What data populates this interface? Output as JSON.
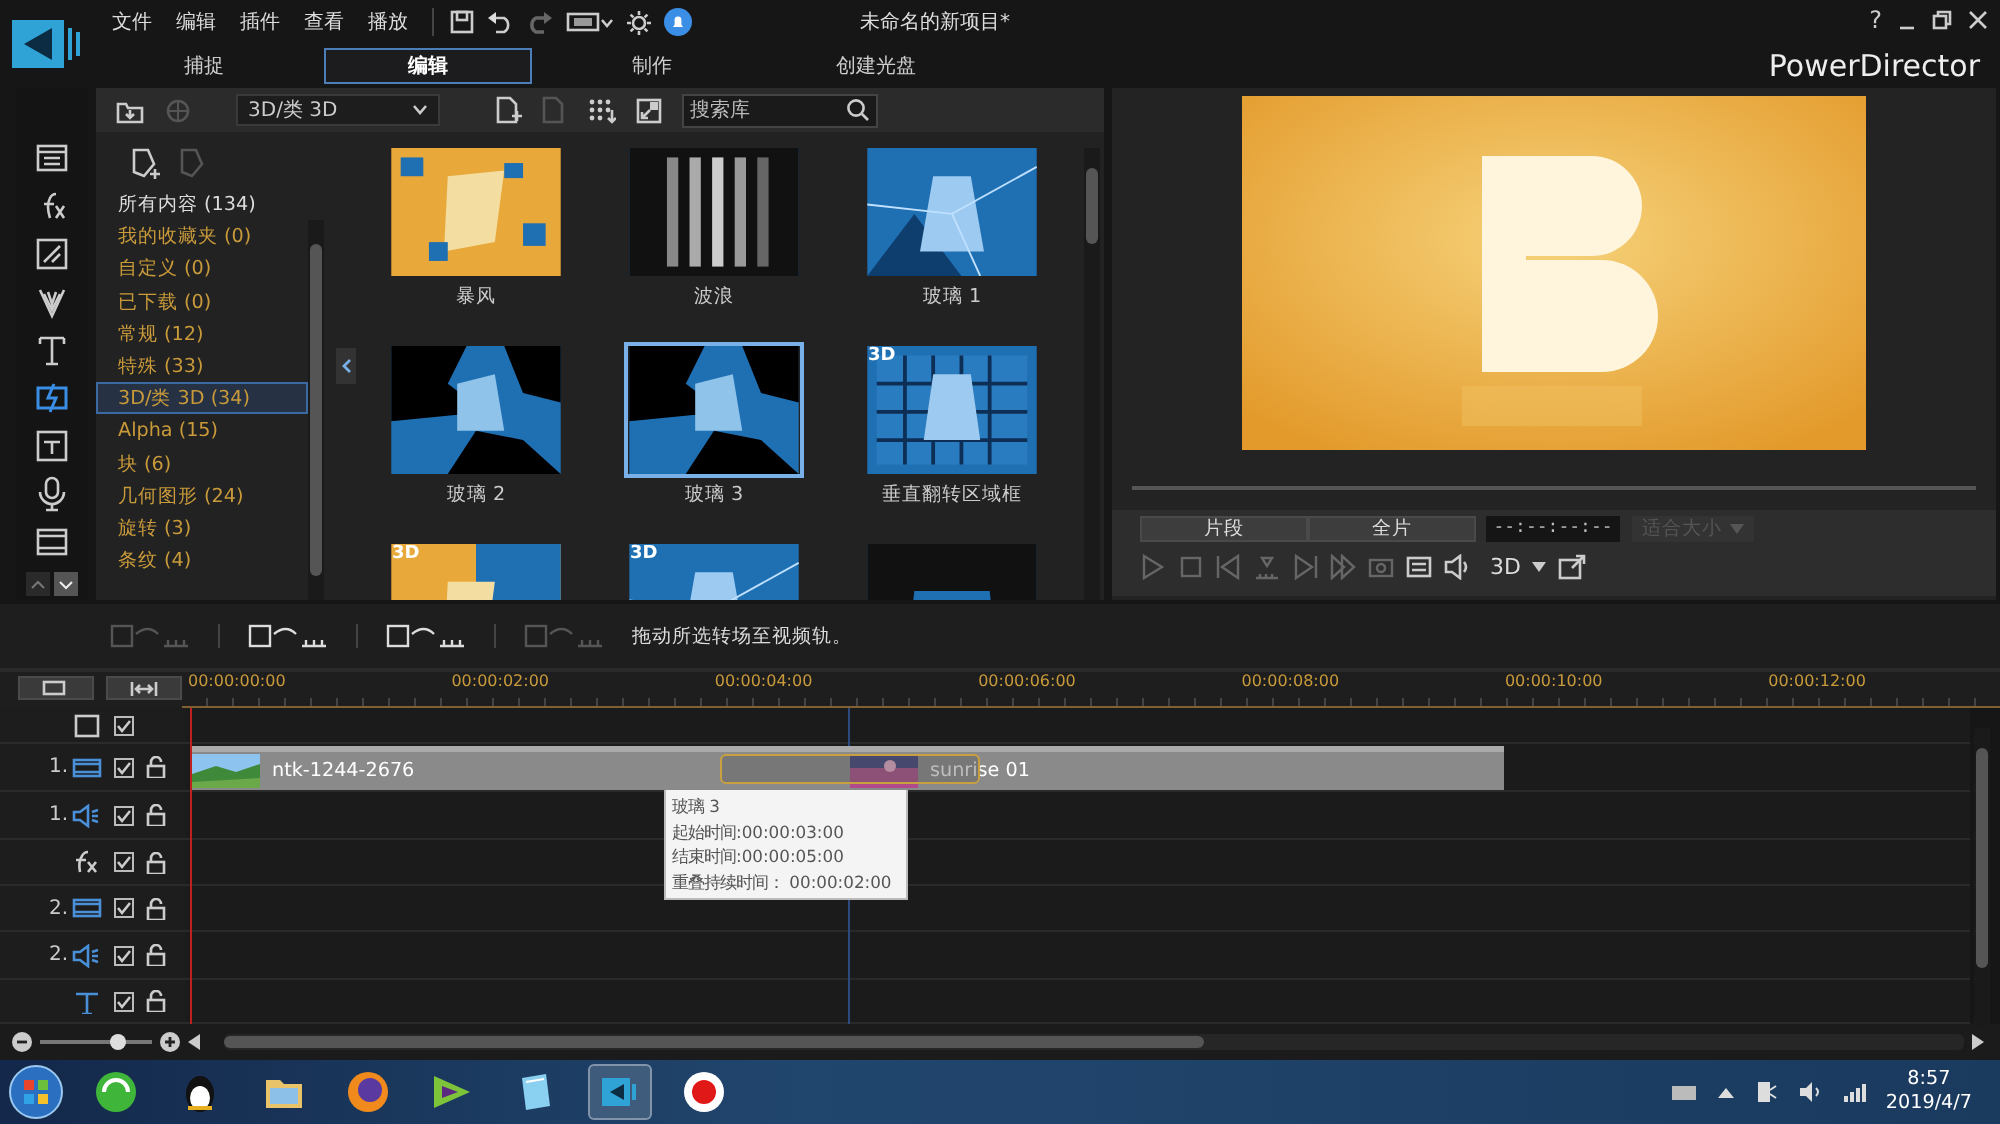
{
  "app": {
    "menu": [
      "文件",
      "编辑",
      "插件",
      "查看",
      "播放"
    ],
    "title": "未命名的新项目*",
    "help": "?",
    "brand": "PowerDirector"
  },
  "tabs": [
    {
      "label": "捕捉",
      "selected": false
    },
    {
      "label": "编辑",
      "selected": true
    },
    {
      "label": "制作",
      "selected": false
    },
    {
      "label": "创建光盘",
      "selected": false
    }
  ],
  "library": {
    "filter": "3D/类 3D",
    "search": {
      "placeholder": "搜索库"
    },
    "categories": [
      {
        "kind": "all",
        "label": "所有内容 (134)",
        "selected": false
      },
      {
        "kind": "group",
        "label": "我的收藏夹 (0)",
        "selected": false
      },
      {
        "kind": "group",
        "label": "自定义 (0)",
        "selected": false
      },
      {
        "kind": "group",
        "label": "已下载 (0)",
        "selected": false
      },
      {
        "kind": "group",
        "label": "常规 (12)",
        "selected": false
      },
      {
        "kind": "group",
        "label": "特殊 (33)",
        "selected": false
      },
      {
        "kind": "group",
        "label": "3D/类 3D (34)",
        "selected": true
      },
      {
        "kind": "group",
        "label": "Alpha (15)",
        "selected": false
      },
      {
        "kind": "group",
        "label": "块 (6)",
        "selected": false
      },
      {
        "kind": "group",
        "label": "几何图形 (24)",
        "selected": false
      },
      {
        "kind": "group",
        "label": "旋转 (3)",
        "selected": false
      },
      {
        "kind": "group",
        "label": "条纹 (4)",
        "selected": false
      }
    ],
    "items": [
      {
        "label": "暴风",
        "selected": false
      },
      {
        "label": "波浪",
        "selected": false
      },
      {
        "label": "玻璃 1",
        "selected": false
      },
      {
        "label": "玻璃 2",
        "selected": false
      },
      {
        "label": "玻璃 3",
        "selected": true
      },
      {
        "label": "垂直翻转区域框",
        "selected": false,
        "badge": "3D"
      },
      {
        "selected": false,
        "badge": "3D"
      },
      {
        "selected": false,
        "badge": "3D"
      },
      {
        "selected": false
      }
    ]
  },
  "preview": {
    "modes": [
      "片段",
      "全片"
    ],
    "timecode": "--:--:--:--",
    "fit": {
      "label": "适合大小",
      "disabled": true
    },
    "stereo": "3D"
  },
  "timeline": {
    "hint": "拖动所选转场至视频轨。",
    "ticks": [
      "00:00:00:00",
      "00:00:02:00",
      "00:00:04:00",
      "00:00:06:00",
      "00:00:08:00",
      "00:00:10:00",
      "00:00:12:00"
    ],
    "tracks": [
      {
        "kind": "master",
        "checked": true
      },
      {
        "kind": "video",
        "number": "1.",
        "checked": true,
        "locked": false,
        "clips": [
          {
            "name": "ntk-1244-2676"
          },
          {
            "name": "sunrise 01"
          }
        ]
      },
      {
        "kind": "audio",
        "number": "1.",
        "checked": true,
        "locked": false
      },
      {
        "kind": "fx",
        "checked": true,
        "locked": false
      },
      {
        "kind": "video",
        "number": "2.",
        "checked": true,
        "locked": false
      },
      {
        "kind": "audio",
        "number": "2.",
        "checked": true,
        "locked": false
      },
      {
        "kind": "title",
        "checked": true,
        "locked": false
      }
    ],
    "tooltip": {
      "title": "玻璃 3",
      "lines": [
        "起始时间:00:00:03:00",
        "结束时间:00:00:05:00",
        "重叠持续时间： 00:00:02:00"
      ]
    },
    "zoom": {
      "level": 0.7
    }
  },
  "taskbar": {
    "time": "8:57",
    "date": "2019/4/7"
  }
}
